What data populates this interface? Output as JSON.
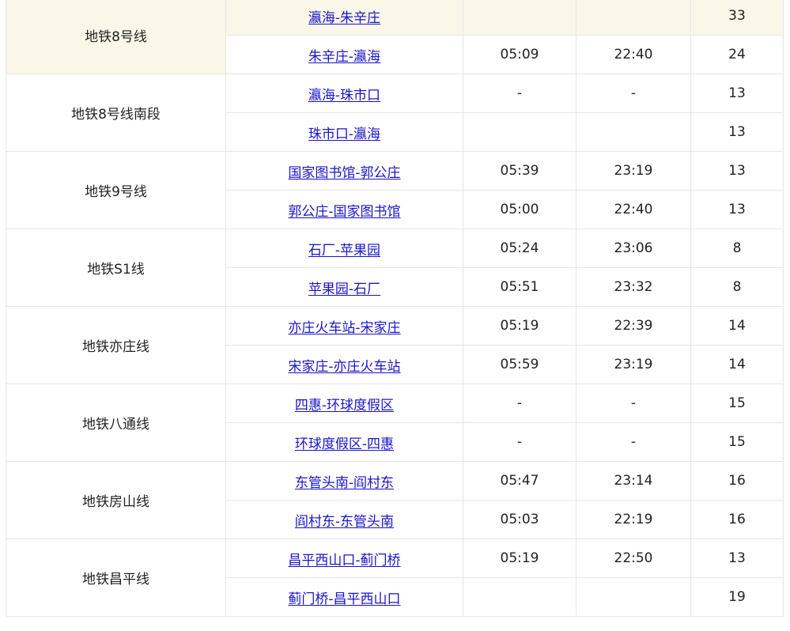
{
  "rows": [
    {
      "line": "地铁8号线",
      "dirs": [
        {
          "route": "瀛海-朱辛庄",
          "first": "",
          "last": "",
          "interval": "33"
        },
        {
          "route": "朱辛庄-瀛海",
          "first": "05:09",
          "last": "22:40",
          "interval": "24"
        }
      ]
    },
    {
      "line": "地铁8号线南段",
      "dirs": [
        {
          "route": "瀛海-珠市口",
          "first": "-",
          "last": "-",
          "interval": "13"
        },
        {
          "route": "珠市口-瀛海",
          "first": "",
          "last": "",
          "interval": "13"
        }
      ]
    },
    {
      "line": "地铁9号线",
      "dirs": [
        {
          "route": "国家图书馆-郭公庄",
          "first": "05:39",
          "last": "23:19",
          "interval": "13"
        },
        {
          "route": "郭公庄-国家图书馆",
          "first": "05:00",
          "last": "22:40",
          "interval": "13"
        }
      ]
    },
    {
      "line": "地铁S1线",
      "dirs": [
        {
          "route": "石厂-苹果园",
          "first": "05:24",
          "last": "23:06",
          "interval": "8"
        },
        {
          "route": "苹果园-石厂",
          "first": "05:51",
          "last": "23:32",
          "interval": "8"
        }
      ]
    },
    {
      "line": "地铁亦庄线",
      "dirs": [
        {
          "route": "亦庄火车站-宋家庄",
          "first": "05:19",
          "last": "22:39",
          "interval": "14"
        },
        {
          "route": "宋家庄-亦庄火车站",
          "first": "05:59",
          "last": "23:19",
          "interval": "14"
        }
      ]
    },
    {
      "line": "地铁八通线",
      "dirs": [
        {
          "route": "四惠-环球度假区",
          "first": "-",
          "last": "-",
          "interval": "15"
        },
        {
          "route": "环球度假区-四惠",
          "first": "-",
          "last": "-",
          "interval": "15"
        }
      ]
    },
    {
      "line": "地铁房山线",
      "dirs": [
        {
          "route": "东管头南-阎村东",
          "first": "05:47",
          "last": "23:14",
          "interval": "16"
        },
        {
          "route": "阎村东-东管头南",
          "first": "05:03",
          "last": "22:19",
          "interval": "16"
        }
      ]
    },
    {
      "line": "地铁昌平线",
      "dirs": [
        {
          "route": "昌平西山口-蓟门桥",
          "first": "05:19",
          "last": "22:50",
          "interval": "13"
        },
        {
          "route": "蓟门桥-昌平西山口",
          "first": "",
          "last": "",
          "interval": "19"
        }
      ]
    }
  ],
  "colors": {
    "highlight_row_bg": "#faf7e8",
    "link": "#1a14c8",
    "border": "#e6e6e6"
  }
}
